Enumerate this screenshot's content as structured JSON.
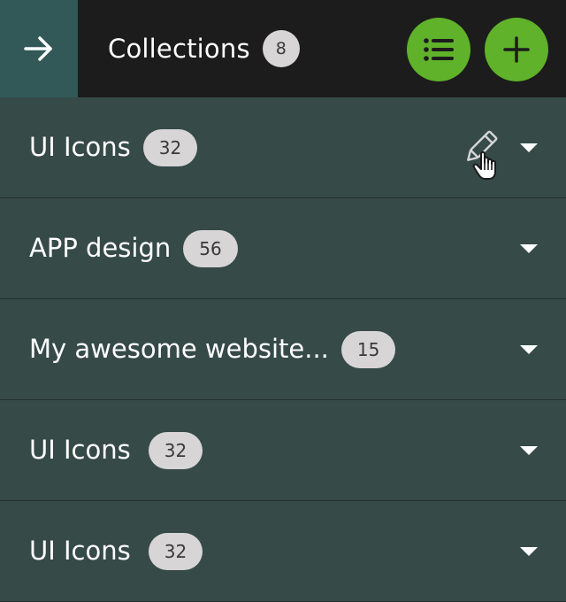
{
  "header": {
    "back_icon": "arrow-right-icon",
    "title": "Collections",
    "count": "8",
    "list_view_icon": "list-icon",
    "add_icon": "plus-icon"
  },
  "collections": [
    {
      "label": "UI Icons",
      "count": "32"
    },
    {
      "label": "APP design",
      "count": "56"
    },
    {
      "label": "My awesome website...",
      "count": "15"
    },
    {
      "label": "UI Icons",
      "count": "32"
    },
    {
      "label": "UI Icons",
      "count": "32"
    }
  ],
  "icons": {
    "expand": "chevron-down-icon",
    "edit": "pencil-icon",
    "cursor": "hand-pointer-icon"
  },
  "colors": {
    "header_bg": "#1c1c1c",
    "back_button_bg": "#325957",
    "accent_green": "#5fb22a",
    "row_bg": "#364a48",
    "row_divider": "#23302f",
    "badge_bg": "#d7d5d5"
  }
}
